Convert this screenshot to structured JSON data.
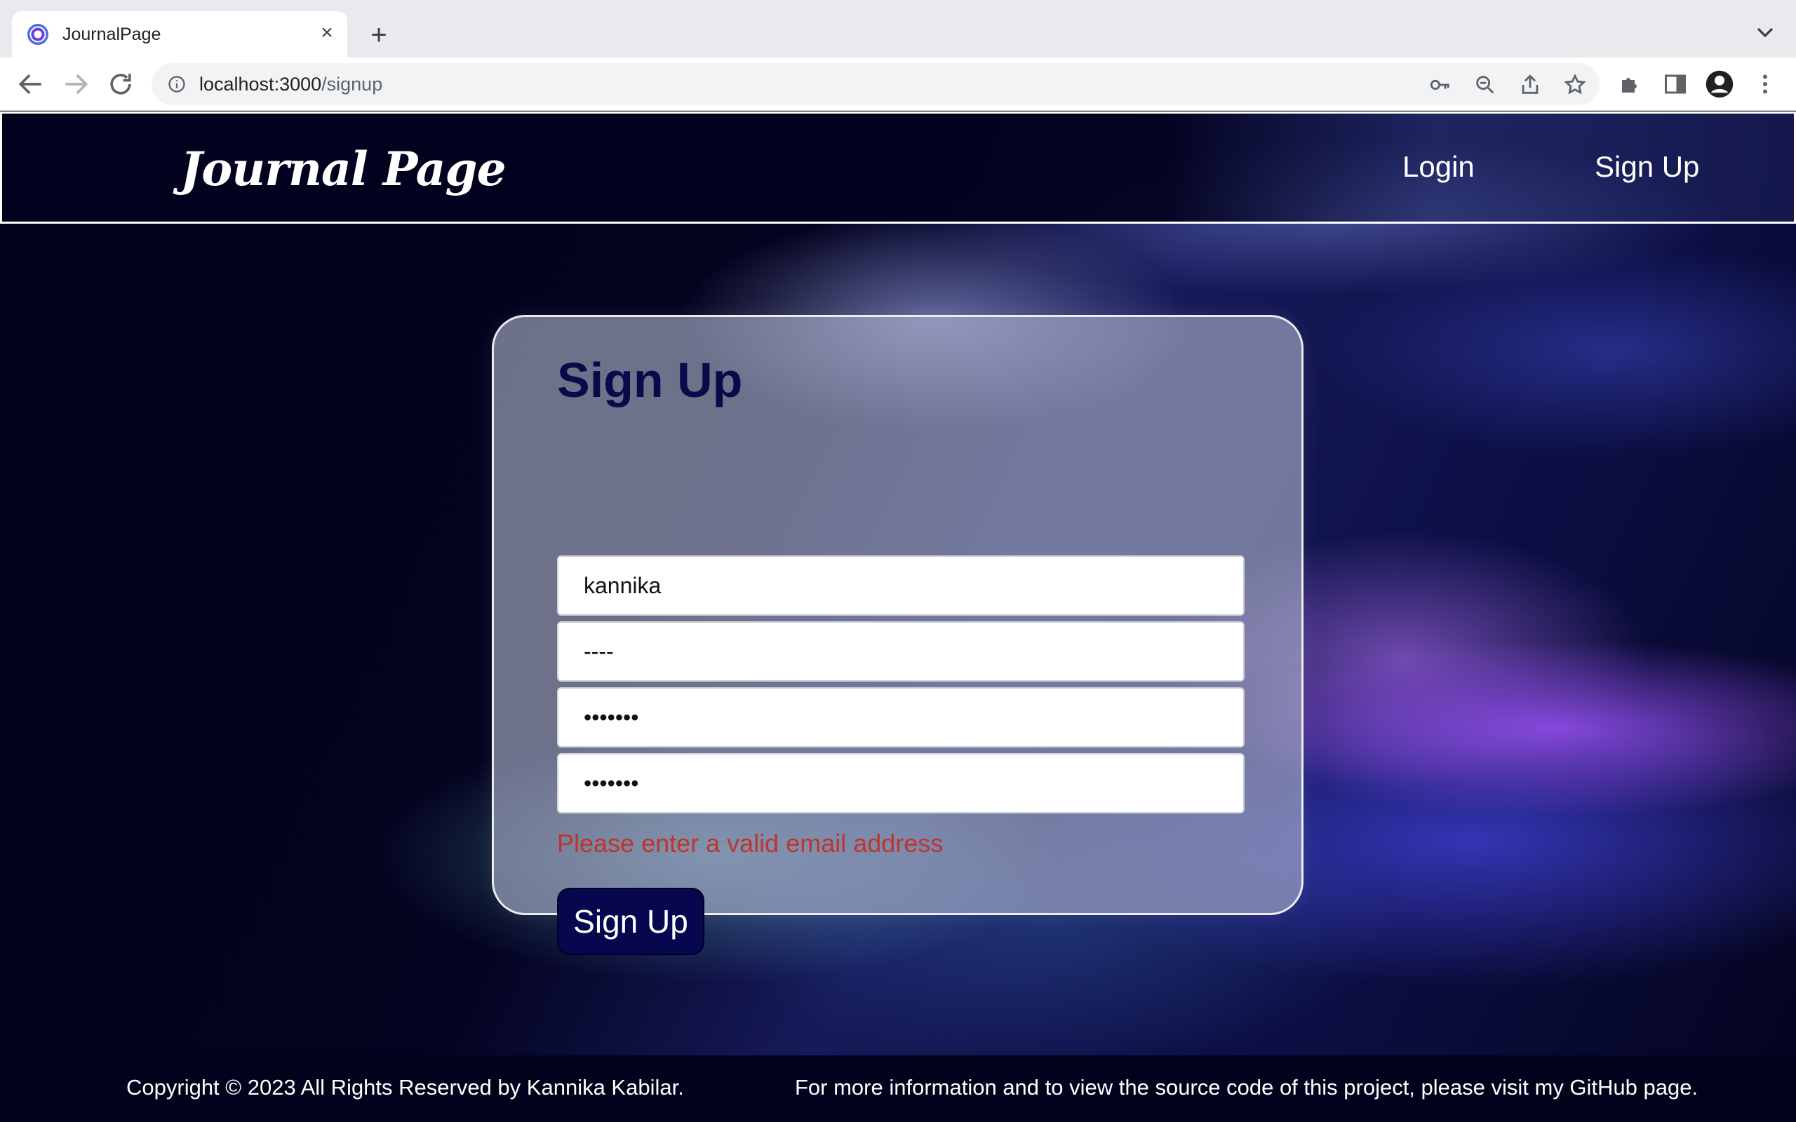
{
  "browser": {
    "tab": {
      "title": "JournalPage"
    },
    "url": {
      "host": "localhost:3000",
      "path": "/signup"
    },
    "icons": [
      "favicon-icon",
      "close-icon",
      "plus-icon",
      "chevron-down-icon",
      "back-arrow-icon",
      "forward-arrow-icon",
      "reload-icon",
      "info-icon",
      "key-icon",
      "zoom-out-icon",
      "share-icon",
      "star-icon",
      "puzzle-icon",
      "sidebar-icon",
      "profile-icon",
      "kebab-menu-icon"
    ]
  },
  "navbar": {
    "brand": "Journal Page",
    "links": [
      "Login",
      "Sign Up"
    ]
  },
  "form": {
    "title": "Sign Up",
    "fields": [
      {
        "value": "kannika",
        "type": "text"
      },
      {
        "value": "----",
        "type": "text"
      },
      {
        "value": "1234567",
        "type": "password"
      },
      {
        "value": "1234567",
        "type": "password"
      }
    ],
    "error": "Please enter a valid email address",
    "submit_label": "Sign Up"
  },
  "footer": {
    "copyright": "Copyright © 2023 All Rights Reserved by Kannika Kabilar.",
    "info": "For more information and to view the source code of this project, please visit my GitHub page."
  },
  "colors": {
    "navy": "#07074f",
    "title": "#0a0a4a",
    "error": "#c0352a"
  }
}
